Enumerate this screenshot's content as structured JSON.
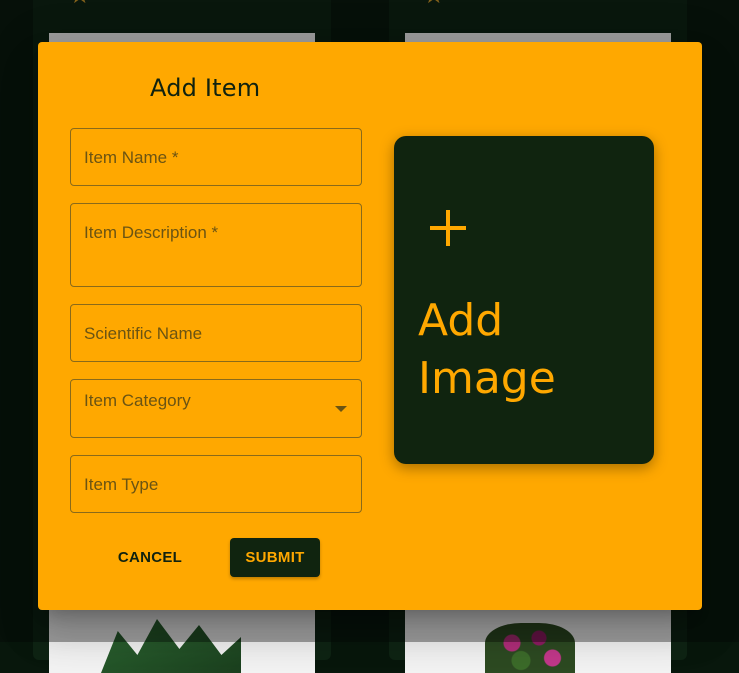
{
  "dialog": {
    "title": "Add Item",
    "fields": {
      "item_name": "Item Name *",
      "item_description": "Item Description *",
      "scientific_name": "Scientific Name",
      "item_category": "Item Category",
      "item_type": "Item Type"
    },
    "buttons": {
      "cancel": "CANCEL",
      "submit": "SUBMIT"
    },
    "add_image": {
      "icon": "plus-icon",
      "label": "Add Image"
    }
  },
  "background": {
    "card_icon": "star-icon",
    "star_glyph": "★"
  },
  "colors": {
    "dialog_bg": "#ffa800",
    "accent_dark": "#10240f",
    "accent_text": "#ffa800"
  }
}
